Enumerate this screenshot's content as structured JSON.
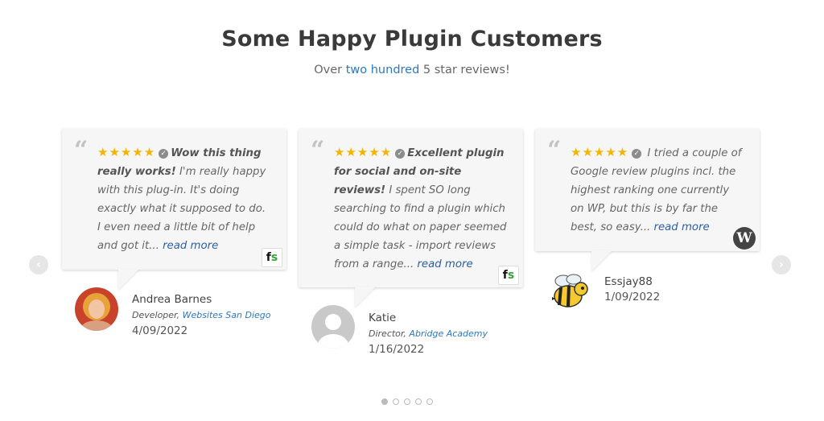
{
  "header": {
    "title": "Some Happy Plugin Customers",
    "subtitle_before": "Over ",
    "subtitle_link": "two hundred",
    "subtitle_after": " 5 star reviews!"
  },
  "reviews": [
    {
      "stars": "★★★★★",
      "check": "✓",
      "headline": "Wow this thing really works!",
      "text": " I'm really happy with this plug-in. It's doing exactly what it supposed to do. I even need a little bit of help and got it... ",
      "more": "read more",
      "source_icon": "freemius-icon",
      "name": "Andrea Barnes",
      "role": "Developer, ",
      "company": "Websites San Diego",
      "date": "4/09/2022"
    },
    {
      "stars": "★★★★★",
      "check": "✓",
      "headline": "Excellent plugin for social and on-site reviews!",
      "text": " I spent SO long searching to find a plugin which could do what on paper seemed a simple task - import reviews from a range... ",
      "more": "read more",
      "source_icon": "freemius-icon",
      "name": "Katie",
      "role": "Director, ",
      "company": "Abridge Academy",
      "date": "1/16/2022"
    },
    {
      "stars": "★★★★★",
      "check": "✓",
      "headline": "",
      "text": " I tried a couple of Google review plugins incl. the highest ranking one currently on WP, but this is by far the best, so easy... ",
      "more": "read more",
      "source_icon": "wordpress-icon",
      "name": "Essjay88",
      "role": "",
      "company": "",
      "date": "1/09/2022"
    }
  ],
  "carousel": {
    "prev_icon": "chevron-left-icon",
    "next_icon": "chevron-right-icon",
    "prev_glyph": "‹",
    "next_glyph": "›",
    "dots": 5,
    "active_dot": 1
  },
  "badges": {
    "freemius": "f",
    "freemius_accent": "s",
    "wordpress": "W"
  },
  "colors": {
    "link": "#2c78c2",
    "star": "#f4b400",
    "card": "#f6f6f6"
  }
}
